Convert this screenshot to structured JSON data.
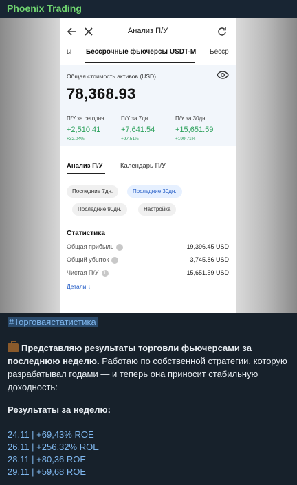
{
  "channel": {
    "name": "Phoenix Trading"
  },
  "app": {
    "title": "Анализ П/У",
    "tabs": [
      {
        "label": "ы"
      },
      {
        "label": "Бессрочные фьючерсы USDT-M"
      },
      {
        "label": "Бесср"
      }
    ],
    "assets": {
      "label": "Общая стоимость активов (USD)",
      "value": "78,368.93"
    },
    "pnl": [
      {
        "label": "П/У за сегодня",
        "value": "+2,510.41",
        "pct": "+32.04%"
      },
      {
        "label": "П/У за 7дн.",
        "value": "+7,641.54",
        "pct": "+97.51%"
      },
      {
        "label": "П/У за 30дн.",
        "value": "+15,651.59",
        "pct": "+199.71%"
      }
    ],
    "subtabs": [
      {
        "label": "Анализ П/У"
      },
      {
        "label": "Календарь П/У"
      }
    ],
    "chips": [
      {
        "label": "Последние 7дн."
      },
      {
        "label": "Последние 30дн."
      },
      {
        "label": "Последние 90дн."
      },
      {
        "label": "Настройка"
      }
    ],
    "stats": {
      "title": "Статистика",
      "rows": [
        {
          "label": "Общая прибыль",
          "value": "19,396.45 USD"
        },
        {
          "label": "Общий убыток",
          "value": "3,745.86 USD"
        },
        {
          "label": "Чистая П/У",
          "value": "15,651.59 USD"
        }
      ],
      "details": "Детали ↓"
    }
  },
  "message": {
    "hashtag": "#Торговаястатистика",
    "intro_bold": "Представляю результаты торговли фьючерсами за последнюю неделю.",
    "intro_rest": " Работаю по собственной стратегии, которую разрабатывал годами — и теперь она приносит стабильную доходность:",
    "results_title": "Результаты за неделю:",
    "results": [
      "24.11 | +69,43% ROE",
      "26.11 | +256,32% ROE",
      "28.11 | +80,36 ROE",
      "29.11 | +59,68 ROE"
    ]
  },
  "colors": {
    "accent_green": "#2aa05a",
    "link_blue": "#7fb7ee",
    "channel_green": "#6fd36f"
  }
}
